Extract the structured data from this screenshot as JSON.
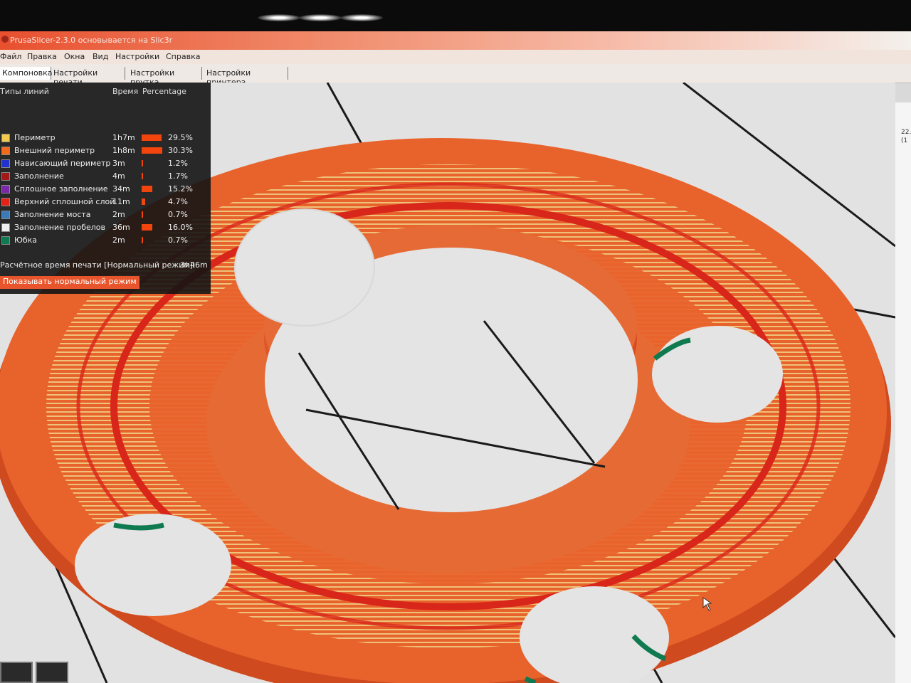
{
  "window": {
    "title": "PrusaSlicer-2.3.0 основывается на Slic3r"
  },
  "menu": [
    "Файл",
    "Правка",
    "Окна",
    "Вид",
    "Настройки",
    "Справка"
  ],
  "tabs": [
    "Компоновка",
    "Настройки печати",
    "Настройки прутка",
    "Настройки принтера"
  ],
  "legend": {
    "headers": {
      "type": "Типы линий",
      "time": "Время",
      "percentage": "Percentage"
    },
    "rows": [
      {
        "name": "Периметр",
        "time": "1h7m",
        "percent": "29.5%",
        "fraction": 0.295,
        "color": "#f2c94c"
      },
      {
        "name": "Внешний периметр",
        "time": "1h8m",
        "percent": "30.3%",
        "fraction": 0.303,
        "color": "#f26a1b"
      },
      {
        "name": "Нависающий периметр",
        "time": "3m",
        "percent": "1.2%",
        "fraction": 0.012,
        "color": "#2233cc"
      },
      {
        "name": "Заполнение",
        "time": "4m",
        "percent": "1.7%",
        "fraction": 0.017,
        "color": "#a01818"
      },
      {
        "name": "Сплошное заполнение",
        "time": "34m",
        "percent": "15.2%",
        "fraction": 0.152,
        "color": "#7a2aa8"
      },
      {
        "name": "Верхний сплошной слой",
        "time": "11m",
        "percent": "4.7%",
        "fraction": 0.047,
        "color": "#e2231a"
      },
      {
        "name": "Заполнение моста",
        "time": "2m",
        "percent": "0.7%",
        "fraction": 0.007,
        "color": "#3a7ab8"
      },
      {
        "name": "Заполнение пробелов",
        "time": "36m",
        "percent": "16.0%",
        "fraction": 0.16,
        "color": "#eeeeee"
      },
      {
        "name": "Юбка",
        "time": "2m",
        "percent": "0.7%",
        "fraction": 0.007,
        "color": "#0f7a50"
      }
    ],
    "estimate_label": "Расчётное время печати [Нормальный режим]:",
    "estimate_value": "3h46m",
    "mode_button": "Показывать нормальный режим"
  },
  "clock": {
    "time": "22.",
    "date": "(1"
  },
  "colors": {
    "accent": "#e8552c",
    "print": "#e8632c"
  }
}
